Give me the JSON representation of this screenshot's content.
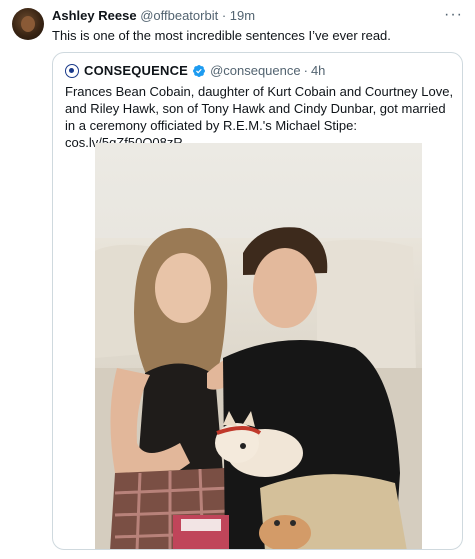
{
  "tweet": {
    "author_name": "Ashley Reese",
    "author_handle": "@offbeatorbit",
    "separator": "·",
    "time": "19m",
    "text": "This is one of the most incredible sentences I’ve ever read.",
    "more_label": "···"
  },
  "quote": {
    "author_name": "CONSEQUENCE",
    "author_handle": "@consequence",
    "separator": "·",
    "time": "4h",
    "text": "Frances Bean Cobain, daughter of Kurt Cobain and Courtney Love, and Riley Hawk, son of Tony Hawk and Cindy Dunbar, got married in a ceremony officiated by R.E.M.'s Michael Stipe: cos.lv/5gZf50Q08zR"
  },
  "icons": {
    "verified": "verified-badge-icon",
    "more": "more-options-icon",
    "logo": "consequence-logo-icon"
  },
  "colors": {
    "verified_blue": "#1d9bf0",
    "secondary_text": "#536471",
    "border": "#cfd9de"
  }
}
